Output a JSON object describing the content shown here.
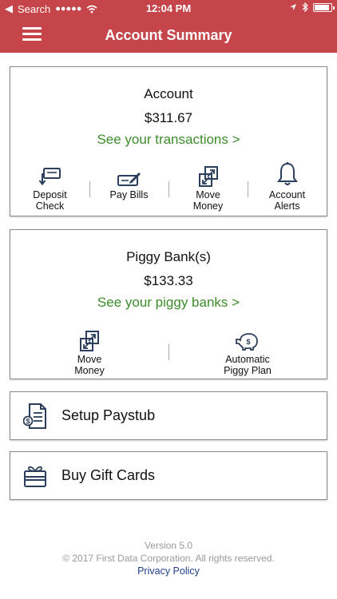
{
  "status_bar": {
    "back_label": "Search",
    "signal": "●●●●●",
    "time": "12:04 PM"
  },
  "nav": {
    "title": "Account Summary"
  },
  "account_card": {
    "title": "Account",
    "amount": "$311.67",
    "link": "See your transactions >",
    "actions": [
      {
        "label": "Deposit\nCheck",
        "icon": "deposit-check-icon"
      },
      {
        "label": "Pay Bills",
        "icon": "pay-bills-icon"
      },
      {
        "label": "Move\nMoney",
        "icon": "move-money-icon"
      },
      {
        "label": "Account\nAlerts",
        "icon": "bell-icon"
      }
    ]
  },
  "piggy_card": {
    "title": "Piggy Bank(s)",
    "amount": "$133.33",
    "link": "See your piggy banks >",
    "actions": [
      {
        "label": "Move\nMoney",
        "icon": "move-money-icon"
      },
      {
        "label": "Automatic\nPiggy Plan",
        "icon": "piggy-bank-icon"
      }
    ]
  },
  "rows": [
    {
      "label": "Setup Paystub",
      "icon": "paystub-icon"
    },
    {
      "label": "Buy Gift Cards",
      "icon": "gift-card-icon"
    }
  ],
  "footer": {
    "version": "Version 5.0",
    "copyright": "© 2017 First Data Corporation. All rights reserved.",
    "privacy": "Privacy Policy"
  },
  "colors": {
    "header": "#c5454a",
    "link_green": "#3b8c2a",
    "icon_blue": "#2b3f5c",
    "privacy_blue": "#1f3f8a"
  }
}
